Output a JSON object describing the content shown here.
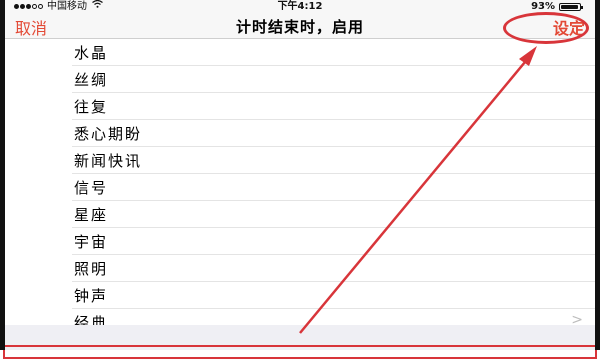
{
  "status_bar": {
    "carrier": "中国移动",
    "time": "下午4:12",
    "battery_text": "93%",
    "battery_level": 0.93
  },
  "nav": {
    "cancel_label": "取消",
    "title": "计时结束时，启用",
    "set_label": "设定"
  },
  "list": {
    "items": [
      {
        "label": "水晶"
      },
      {
        "label": "丝绸"
      },
      {
        "label": "往复"
      },
      {
        "label": "悉心期盼"
      },
      {
        "label": "新闻快讯"
      },
      {
        "label": "信号"
      },
      {
        "label": "星座"
      },
      {
        "label": "宇宙"
      },
      {
        "label": "照明"
      },
      {
        "label": "钟声"
      },
      {
        "label": "经典",
        "chevron": ">"
      }
    ]
  },
  "annotation": {
    "color": "#d8353a"
  }
}
